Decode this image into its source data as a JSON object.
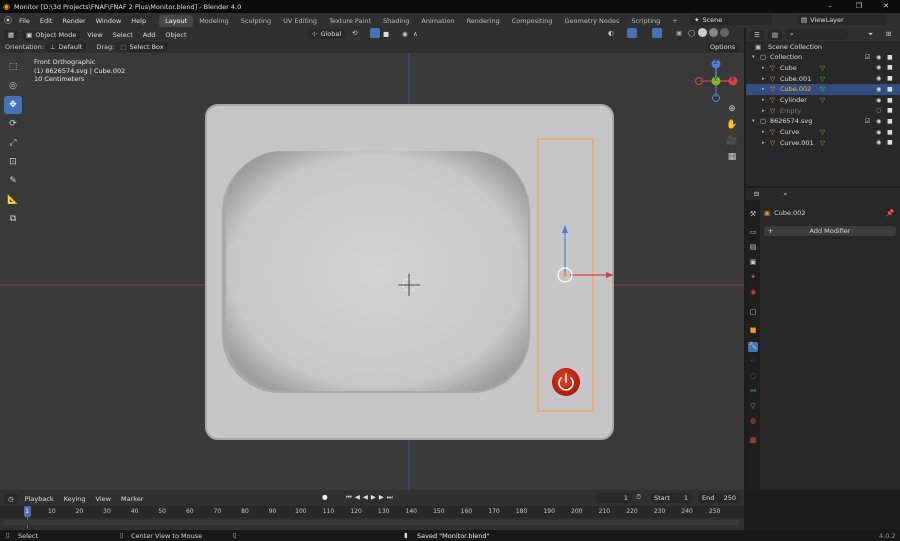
{
  "window": {
    "title": "Monitor [D:\\3d Projects\\FNAF\\FNAF 2 Plus\\Monitor.blend] - Blender 4.0",
    "minimize": "–",
    "maximize": "❐",
    "close": "✕"
  },
  "menus": [
    "File",
    "Edit",
    "Render",
    "Window",
    "Help"
  ],
  "workspaces": [
    "Layout",
    "Modeling",
    "Sculpting",
    "UV Editing",
    "Texture Paint",
    "Shading",
    "Animation",
    "Rendering",
    "Compositing",
    "Geometry Nodes",
    "Scripting"
  ],
  "active_workspace": "Layout",
  "add_workspace": "+",
  "scene": {
    "label": "Scene",
    "view_layer": "ViewLayer"
  },
  "viewport_header": {
    "mode": "Object Mode",
    "menus": [
      "View",
      "Select",
      "Add",
      "Object"
    ],
    "transform_orientation": "Global",
    "orientation_label": "Orientation:",
    "orientation_value": "Default",
    "drag_label": "Drag:",
    "drag_value": "Select Box",
    "options": "Options"
  },
  "viewport_info": {
    "view": "Front Orthographic",
    "object": "(1) 8626574.svg | Cube.002",
    "scale": "10 Centimeters"
  },
  "gizmo": {
    "x": "X",
    "y": "Y",
    "z": "Z"
  },
  "outliner": {
    "title": "Scene Collection",
    "rows": [
      {
        "label": "Collection",
        "indent": 1,
        "state": "normal"
      },
      {
        "label": "Cube",
        "indent": 2,
        "state": "normal"
      },
      {
        "label": "Cube.001",
        "indent": 2,
        "state": "normal"
      },
      {
        "label": "Cube.002",
        "indent": 2,
        "state": "selected"
      },
      {
        "label": "Cylinder",
        "indent": 2,
        "state": "normal"
      },
      {
        "label": "Empty",
        "indent": 2,
        "state": "dim"
      },
      {
        "label": "8626574.svg",
        "indent": 1,
        "state": "normal"
      },
      {
        "label": "Curve",
        "indent": 2,
        "state": "normal"
      },
      {
        "label": "Curve.001",
        "indent": 2,
        "state": "normal"
      }
    ]
  },
  "properties": {
    "object_name": "Cube.002",
    "add_modifier": "Add Modifier"
  },
  "timeline": {
    "menus": [
      "Playback",
      "Keying",
      "View",
      "Marker"
    ],
    "current_frame": "1",
    "start_label": "Start",
    "start": "1",
    "end_label": "End",
    "end": "250",
    "ticks": [
      "1",
      "10",
      "20",
      "30",
      "40",
      "50",
      "60",
      "70",
      "80",
      "90",
      "100",
      "110",
      "120",
      "130",
      "140",
      "150",
      "160",
      "170",
      "180",
      "190",
      "200",
      "210",
      "220",
      "230",
      "240",
      "250"
    ]
  },
  "status": {
    "select": "Select",
    "center_view": "Center View to Mouse",
    "saved": "Saved \"Monitor.blend\"",
    "version": "4.0.2"
  },
  "colors": {
    "accent": "#4772b3",
    "selection_orange": "#ff9a2a",
    "axis_red": "#d7424a",
    "axis_blue": "#4e80d8",
    "axis_green": "#7ab825",
    "power_button": "#d42a17"
  }
}
